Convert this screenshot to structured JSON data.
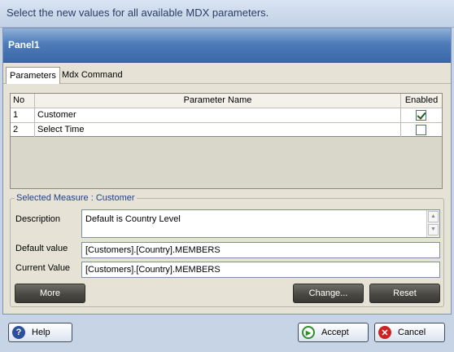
{
  "instruction": "Select the new values for all available MDX parameters.",
  "panel": {
    "title": "Panel1"
  },
  "tabs": [
    {
      "label": "Parameters",
      "active": true
    },
    {
      "label": "Mdx Command",
      "active": false
    }
  ],
  "grid": {
    "columns": [
      "No",
      "Parameter Name",
      "Enabled"
    ],
    "rows": [
      {
        "no": "1",
        "name": "Customer",
        "enabled": true
      },
      {
        "no": "2",
        "name": "Select Time",
        "enabled": false
      }
    ]
  },
  "measure": {
    "title": "Selected Measure : Customer",
    "description_label": "Description",
    "description_value": "Default is Country Level",
    "default_label": "Default value",
    "default_value": "[Customers].[Country].MEMBERS",
    "current_label": "Current Value",
    "current_value": "[Customers].[Country].MEMBERS",
    "more_label": "More",
    "change_label": "Change...",
    "reset_label": "Reset"
  },
  "footer": {
    "help_label": "Help",
    "accept_label": "Accept",
    "cancel_label": "Cancel"
  },
  "icons": {
    "help": "help-icon",
    "accept": "accept-icon",
    "cancel": "cancel-icon"
  },
  "colors": {
    "header_blue": "#3a68a8",
    "group_title": "#1f3f82",
    "help_icon": "#2d4fa0",
    "accept_icon": "#2f8f2f",
    "cancel_icon": "#cc2222"
  }
}
